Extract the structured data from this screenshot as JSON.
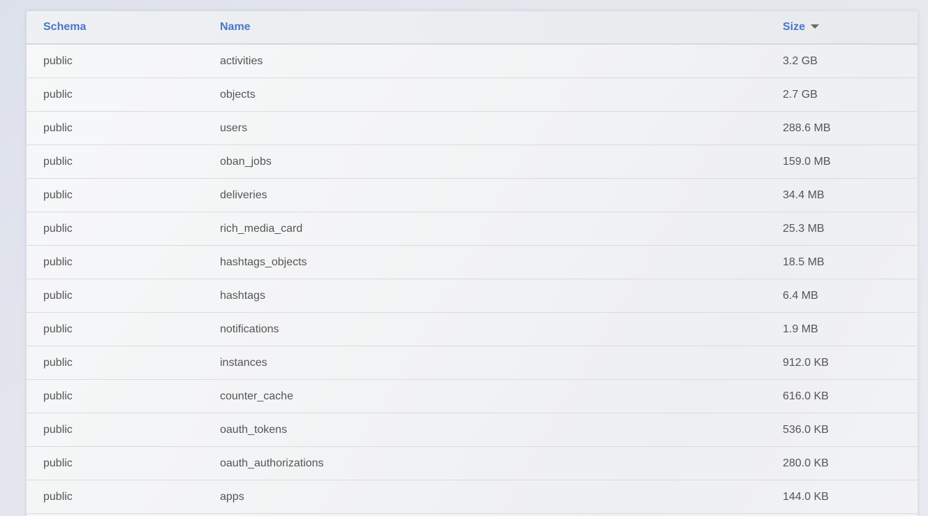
{
  "table": {
    "headers": {
      "schema": "Schema",
      "name": "Name",
      "size": "Size"
    },
    "sort": {
      "column": "size",
      "direction": "desc",
      "icon": "caret-down-icon"
    },
    "rows": [
      {
        "schema": "public",
        "name": "activities",
        "size": "3.2 GB"
      },
      {
        "schema": "public",
        "name": "objects",
        "size": "2.7 GB"
      },
      {
        "schema": "public",
        "name": "users",
        "size": "288.6 MB"
      },
      {
        "schema": "public",
        "name": "oban_jobs",
        "size": "159.0 MB"
      },
      {
        "schema": "public",
        "name": "deliveries",
        "size": "34.4 MB"
      },
      {
        "schema": "public",
        "name": "rich_media_card",
        "size": "25.3 MB"
      },
      {
        "schema": "public",
        "name": "hashtags_objects",
        "size": "18.5 MB"
      },
      {
        "schema": "public",
        "name": "hashtags",
        "size": "6.4 MB"
      },
      {
        "schema": "public",
        "name": "notifications",
        "size": "1.9 MB"
      },
      {
        "schema": "public",
        "name": "instances",
        "size": "912.0 KB"
      },
      {
        "schema": "public",
        "name": "counter_cache",
        "size": "616.0 KB"
      },
      {
        "schema": "public",
        "name": "oauth_tokens",
        "size": "536.0 KB"
      },
      {
        "schema": "public",
        "name": "oauth_authorizations",
        "size": "280.0 KB"
      },
      {
        "schema": "public",
        "name": "apps",
        "size": "144.0 KB"
      }
    ]
  },
  "colors": {
    "header_text": "#4a77c4",
    "cell_text": "#555555",
    "row_border": "#d9dbdf"
  }
}
